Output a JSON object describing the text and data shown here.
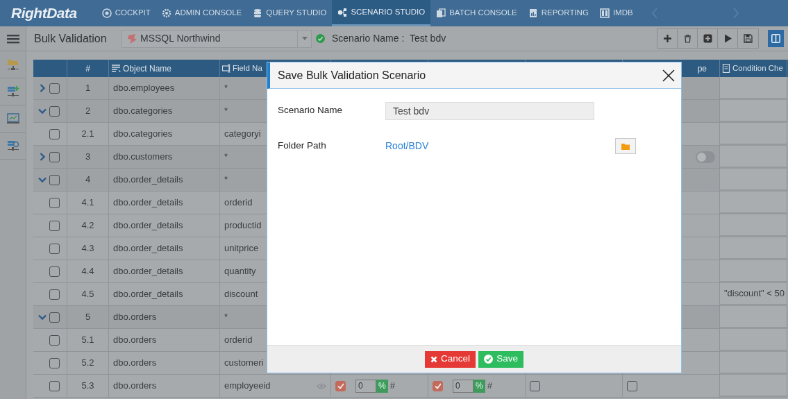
{
  "nav": {
    "logo": "RightData",
    "items": [
      {
        "label": "COCKPIT",
        "selected": false
      },
      {
        "label": "ADMIN CONSOLE",
        "selected": false
      },
      {
        "label": "QUERY STUDIO",
        "selected": false
      },
      {
        "label": "SCENARIO STUDIO",
        "selected": true
      },
      {
        "label": "BATCH CONSOLE",
        "selected": false
      },
      {
        "label": "REPORTING",
        "selected": false
      },
      {
        "label": "IMDB",
        "selected": false
      }
    ]
  },
  "toolbar": {
    "title": "Bulk Validation",
    "connection": {
      "value": "MSSQL Northwind"
    },
    "connected": true,
    "scenario_label": "Scenario Name :",
    "scenario_name": "Test bdv"
  },
  "table": {
    "columns": [
      {
        "label": "#"
      },
      {
        "label": "Object Name"
      },
      {
        "label": "Field Na"
      },
      {
        "label": "pe"
      },
      {
        "label": "Condition Che"
      }
    ],
    "rows": [
      {
        "kind": "parent",
        "expanded": false,
        "checked": false,
        "number": "1",
        "object": "dbo.employees",
        "field": "*"
      },
      {
        "kind": "parent",
        "expanded": true,
        "checked": false,
        "number": "2",
        "object": "dbo.categories",
        "field": "*"
      },
      {
        "kind": "child",
        "checked": false,
        "number": "2.1",
        "object": "dbo.categories",
        "field": "categoryi"
      },
      {
        "kind": "parent",
        "expanded": false,
        "checked": false,
        "number": "3",
        "object": "dbo.customers",
        "field": "*",
        "type_toggle": {
          "on": false
        }
      },
      {
        "kind": "parent",
        "expanded": true,
        "checked": false,
        "number": "4",
        "object": "dbo.order_details",
        "field": "*"
      },
      {
        "kind": "child",
        "checked": false,
        "number": "4.1",
        "object": "dbo.order_details",
        "field": "orderid"
      },
      {
        "kind": "child",
        "checked": false,
        "number": "4.2",
        "object": "dbo.order_details",
        "field": "productid"
      },
      {
        "kind": "child",
        "checked": false,
        "number": "4.3",
        "object": "dbo.order_details",
        "field": "unitprice"
      },
      {
        "kind": "child",
        "checked": false,
        "number": "4.4",
        "object": "dbo.order_details",
        "field": "quantity"
      },
      {
        "kind": "child",
        "checked": false,
        "number": "4.5",
        "object": "dbo.order_details",
        "field": "discount",
        "condition": "\"discount\" < 50"
      },
      {
        "kind": "parent",
        "expanded": true,
        "checked": false,
        "number": "5",
        "object": "dbo.orders",
        "field": "*"
      },
      {
        "kind": "child",
        "checked": false,
        "number": "5.1",
        "object": "dbo.orders",
        "field": "orderid"
      },
      {
        "kind": "child",
        "checked": false,
        "number": "5.2",
        "object": "dbo.orders",
        "field": "customeri"
      },
      {
        "kind": "child",
        "checked": false,
        "number": "5.3",
        "object": "dbo.orders",
        "field": "employeeid",
        "checks": [
          {
            "checked": true,
            "value": "0",
            "unit": "%",
            "suffix": "#"
          },
          {
            "checked": true,
            "value": "0",
            "unit": "%",
            "suffix": "#"
          }
        ],
        "flags": [
          {
            "checked": false
          },
          {
            "checked": false
          }
        ]
      }
    ]
  },
  "dialog": {
    "title": "Save Bulk Validation Scenario",
    "fields": [
      {
        "label": "Scenario Name",
        "kind": "input",
        "value": "Test bdv"
      },
      {
        "label": "Folder Path",
        "kind": "link",
        "value": "Root/BDV"
      }
    ],
    "buttons": [
      {
        "label": "Cancel",
        "kind": "cancel"
      },
      {
        "label": "Save",
        "kind": "save"
      }
    ]
  }
}
